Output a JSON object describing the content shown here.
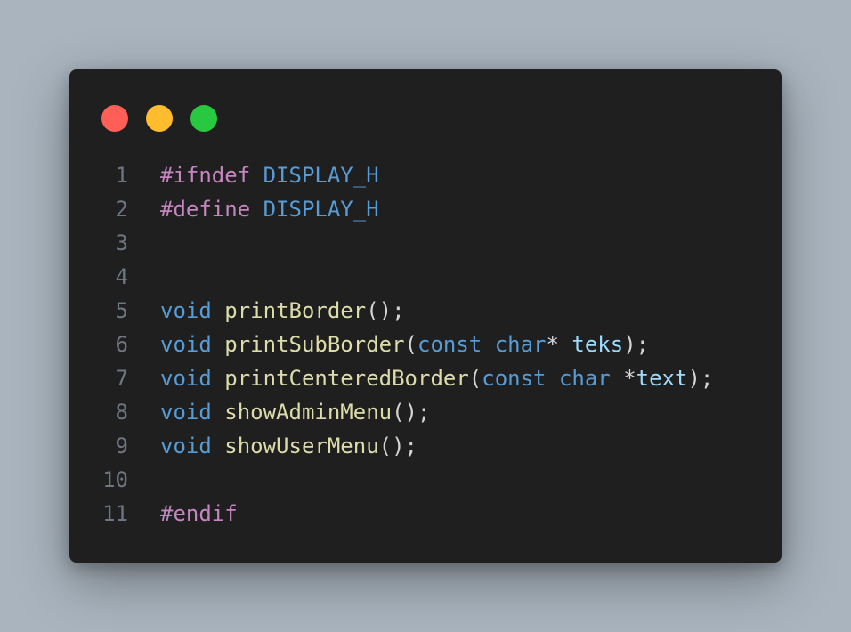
{
  "colors": {
    "background": "#a9b4be",
    "window": "#1f1f1f",
    "line_number": "#6e7681",
    "preprocessor": "#c586c0",
    "keyword": "#569cd6",
    "function": "#dcdcaa",
    "variable": "#9cdcfe",
    "punctuation": "#d4d4d4"
  },
  "window_controls": [
    {
      "name": "close",
      "icon": "red-circle-icon",
      "color": "#ff5f57"
    },
    {
      "name": "minimize",
      "icon": "yellow-circle-icon",
      "color": "#febc2e"
    },
    {
      "name": "maximize",
      "icon": "green-circle-icon",
      "color": "#28c840"
    }
  ],
  "code_lines": [
    {
      "number": "1",
      "tokens": [
        {
          "type": "pre",
          "text": "#ifndef"
        },
        {
          "type": "punc",
          "text": " "
        },
        {
          "type": "macro",
          "text": "DISPLAY_H"
        }
      ]
    },
    {
      "number": "2",
      "tokens": [
        {
          "type": "pre",
          "text": "#define"
        },
        {
          "type": "punc",
          "text": " "
        },
        {
          "type": "macro",
          "text": "DISPLAY_H"
        }
      ]
    },
    {
      "number": "3",
      "tokens": []
    },
    {
      "number": "4",
      "tokens": []
    },
    {
      "number": "5",
      "tokens": [
        {
          "type": "kw",
          "text": "void"
        },
        {
          "type": "punc",
          "text": " "
        },
        {
          "type": "fn",
          "text": "printBorder"
        },
        {
          "type": "punc",
          "text": "();"
        }
      ]
    },
    {
      "number": "6",
      "tokens": [
        {
          "type": "kw",
          "text": "void"
        },
        {
          "type": "punc",
          "text": " "
        },
        {
          "type": "fn",
          "text": "printSubBorder"
        },
        {
          "type": "punc",
          "text": "("
        },
        {
          "type": "kw",
          "text": "const"
        },
        {
          "type": "punc",
          "text": " "
        },
        {
          "type": "kw",
          "text": "char"
        },
        {
          "type": "punc",
          "text": "* "
        },
        {
          "type": "var",
          "text": "teks"
        },
        {
          "type": "punc",
          "text": ");"
        }
      ]
    },
    {
      "number": "7",
      "tokens": [
        {
          "type": "kw",
          "text": "void"
        },
        {
          "type": "punc",
          "text": " "
        },
        {
          "type": "fn",
          "text": "printCenteredBorder"
        },
        {
          "type": "punc",
          "text": "("
        },
        {
          "type": "kw",
          "text": "const"
        },
        {
          "type": "punc",
          "text": " "
        },
        {
          "type": "kw",
          "text": "char"
        },
        {
          "type": "punc",
          "text": " *"
        },
        {
          "type": "var",
          "text": "text"
        },
        {
          "type": "punc",
          "text": ");"
        }
      ]
    },
    {
      "number": "8",
      "tokens": [
        {
          "type": "kw",
          "text": "void"
        },
        {
          "type": "punc",
          "text": " "
        },
        {
          "type": "fn",
          "text": "showAdminMenu"
        },
        {
          "type": "punc",
          "text": "();"
        }
      ]
    },
    {
      "number": "9",
      "tokens": [
        {
          "type": "kw",
          "text": "void"
        },
        {
          "type": "punc",
          "text": " "
        },
        {
          "type": "fn",
          "text": "showUserMenu"
        },
        {
          "type": "punc",
          "text": "();"
        }
      ]
    },
    {
      "number": "10",
      "tokens": []
    },
    {
      "number": "11",
      "tokens": [
        {
          "type": "pre",
          "text": "#endif"
        }
      ]
    }
  ]
}
